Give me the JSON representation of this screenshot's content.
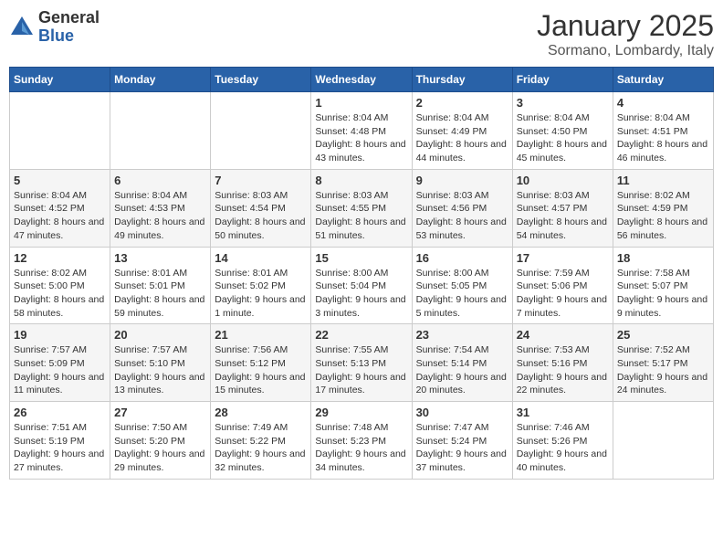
{
  "logo": {
    "general": "General",
    "blue": "Blue"
  },
  "title": "January 2025",
  "location": "Sormano, Lombardy, Italy",
  "days_of_week": [
    "Sunday",
    "Monday",
    "Tuesday",
    "Wednesday",
    "Thursday",
    "Friday",
    "Saturday"
  ],
  "weeks": [
    [
      {
        "day": "",
        "info": ""
      },
      {
        "day": "",
        "info": ""
      },
      {
        "day": "",
        "info": ""
      },
      {
        "day": "1",
        "info": "Sunrise: 8:04 AM\nSunset: 4:48 PM\nDaylight: 8 hours and 43 minutes."
      },
      {
        "day": "2",
        "info": "Sunrise: 8:04 AM\nSunset: 4:49 PM\nDaylight: 8 hours and 44 minutes."
      },
      {
        "day": "3",
        "info": "Sunrise: 8:04 AM\nSunset: 4:50 PM\nDaylight: 8 hours and 45 minutes."
      },
      {
        "day": "4",
        "info": "Sunrise: 8:04 AM\nSunset: 4:51 PM\nDaylight: 8 hours and 46 minutes."
      }
    ],
    [
      {
        "day": "5",
        "info": "Sunrise: 8:04 AM\nSunset: 4:52 PM\nDaylight: 8 hours and 47 minutes."
      },
      {
        "day": "6",
        "info": "Sunrise: 8:04 AM\nSunset: 4:53 PM\nDaylight: 8 hours and 49 minutes."
      },
      {
        "day": "7",
        "info": "Sunrise: 8:03 AM\nSunset: 4:54 PM\nDaylight: 8 hours and 50 minutes."
      },
      {
        "day": "8",
        "info": "Sunrise: 8:03 AM\nSunset: 4:55 PM\nDaylight: 8 hours and 51 minutes."
      },
      {
        "day": "9",
        "info": "Sunrise: 8:03 AM\nSunset: 4:56 PM\nDaylight: 8 hours and 53 minutes."
      },
      {
        "day": "10",
        "info": "Sunrise: 8:03 AM\nSunset: 4:57 PM\nDaylight: 8 hours and 54 minutes."
      },
      {
        "day": "11",
        "info": "Sunrise: 8:02 AM\nSunset: 4:59 PM\nDaylight: 8 hours and 56 minutes."
      }
    ],
    [
      {
        "day": "12",
        "info": "Sunrise: 8:02 AM\nSunset: 5:00 PM\nDaylight: 8 hours and 58 minutes."
      },
      {
        "day": "13",
        "info": "Sunrise: 8:01 AM\nSunset: 5:01 PM\nDaylight: 8 hours and 59 minutes."
      },
      {
        "day": "14",
        "info": "Sunrise: 8:01 AM\nSunset: 5:02 PM\nDaylight: 9 hours and 1 minute."
      },
      {
        "day": "15",
        "info": "Sunrise: 8:00 AM\nSunset: 5:04 PM\nDaylight: 9 hours and 3 minutes."
      },
      {
        "day": "16",
        "info": "Sunrise: 8:00 AM\nSunset: 5:05 PM\nDaylight: 9 hours and 5 minutes."
      },
      {
        "day": "17",
        "info": "Sunrise: 7:59 AM\nSunset: 5:06 PM\nDaylight: 9 hours and 7 minutes."
      },
      {
        "day": "18",
        "info": "Sunrise: 7:58 AM\nSunset: 5:07 PM\nDaylight: 9 hours and 9 minutes."
      }
    ],
    [
      {
        "day": "19",
        "info": "Sunrise: 7:57 AM\nSunset: 5:09 PM\nDaylight: 9 hours and 11 minutes."
      },
      {
        "day": "20",
        "info": "Sunrise: 7:57 AM\nSunset: 5:10 PM\nDaylight: 9 hours and 13 minutes."
      },
      {
        "day": "21",
        "info": "Sunrise: 7:56 AM\nSunset: 5:12 PM\nDaylight: 9 hours and 15 minutes."
      },
      {
        "day": "22",
        "info": "Sunrise: 7:55 AM\nSunset: 5:13 PM\nDaylight: 9 hours and 17 minutes."
      },
      {
        "day": "23",
        "info": "Sunrise: 7:54 AM\nSunset: 5:14 PM\nDaylight: 9 hours and 20 minutes."
      },
      {
        "day": "24",
        "info": "Sunrise: 7:53 AM\nSunset: 5:16 PM\nDaylight: 9 hours and 22 minutes."
      },
      {
        "day": "25",
        "info": "Sunrise: 7:52 AM\nSunset: 5:17 PM\nDaylight: 9 hours and 24 minutes."
      }
    ],
    [
      {
        "day": "26",
        "info": "Sunrise: 7:51 AM\nSunset: 5:19 PM\nDaylight: 9 hours and 27 minutes."
      },
      {
        "day": "27",
        "info": "Sunrise: 7:50 AM\nSunset: 5:20 PM\nDaylight: 9 hours and 29 minutes."
      },
      {
        "day": "28",
        "info": "Sunrise: 7:49 AM\nSunset: 5:22 PM\nDaylight: 9 hours and 32 minutes."
      },
      {
        "day": "29",
        "info": "Sunrise: 7:48 AM\nSunset: 5:23 PM\nDaylight: 9 hours and 34 minutes."
      },
      {
        "day": "30",
        "info": "Sunrise: 7:47 AM\nSunset: 5:24 PM\nDaylight: 9 hours and 37 minutes."
      },
      {
        "day": "31",
        "info": "Sunrise: 7:46 AM\nSunset: 5:26 PM\nDaylight: 9 hours and 40 minutes."
      },
      {
        "day": "",
        "info": ""
      }
    ]
  ]
}
